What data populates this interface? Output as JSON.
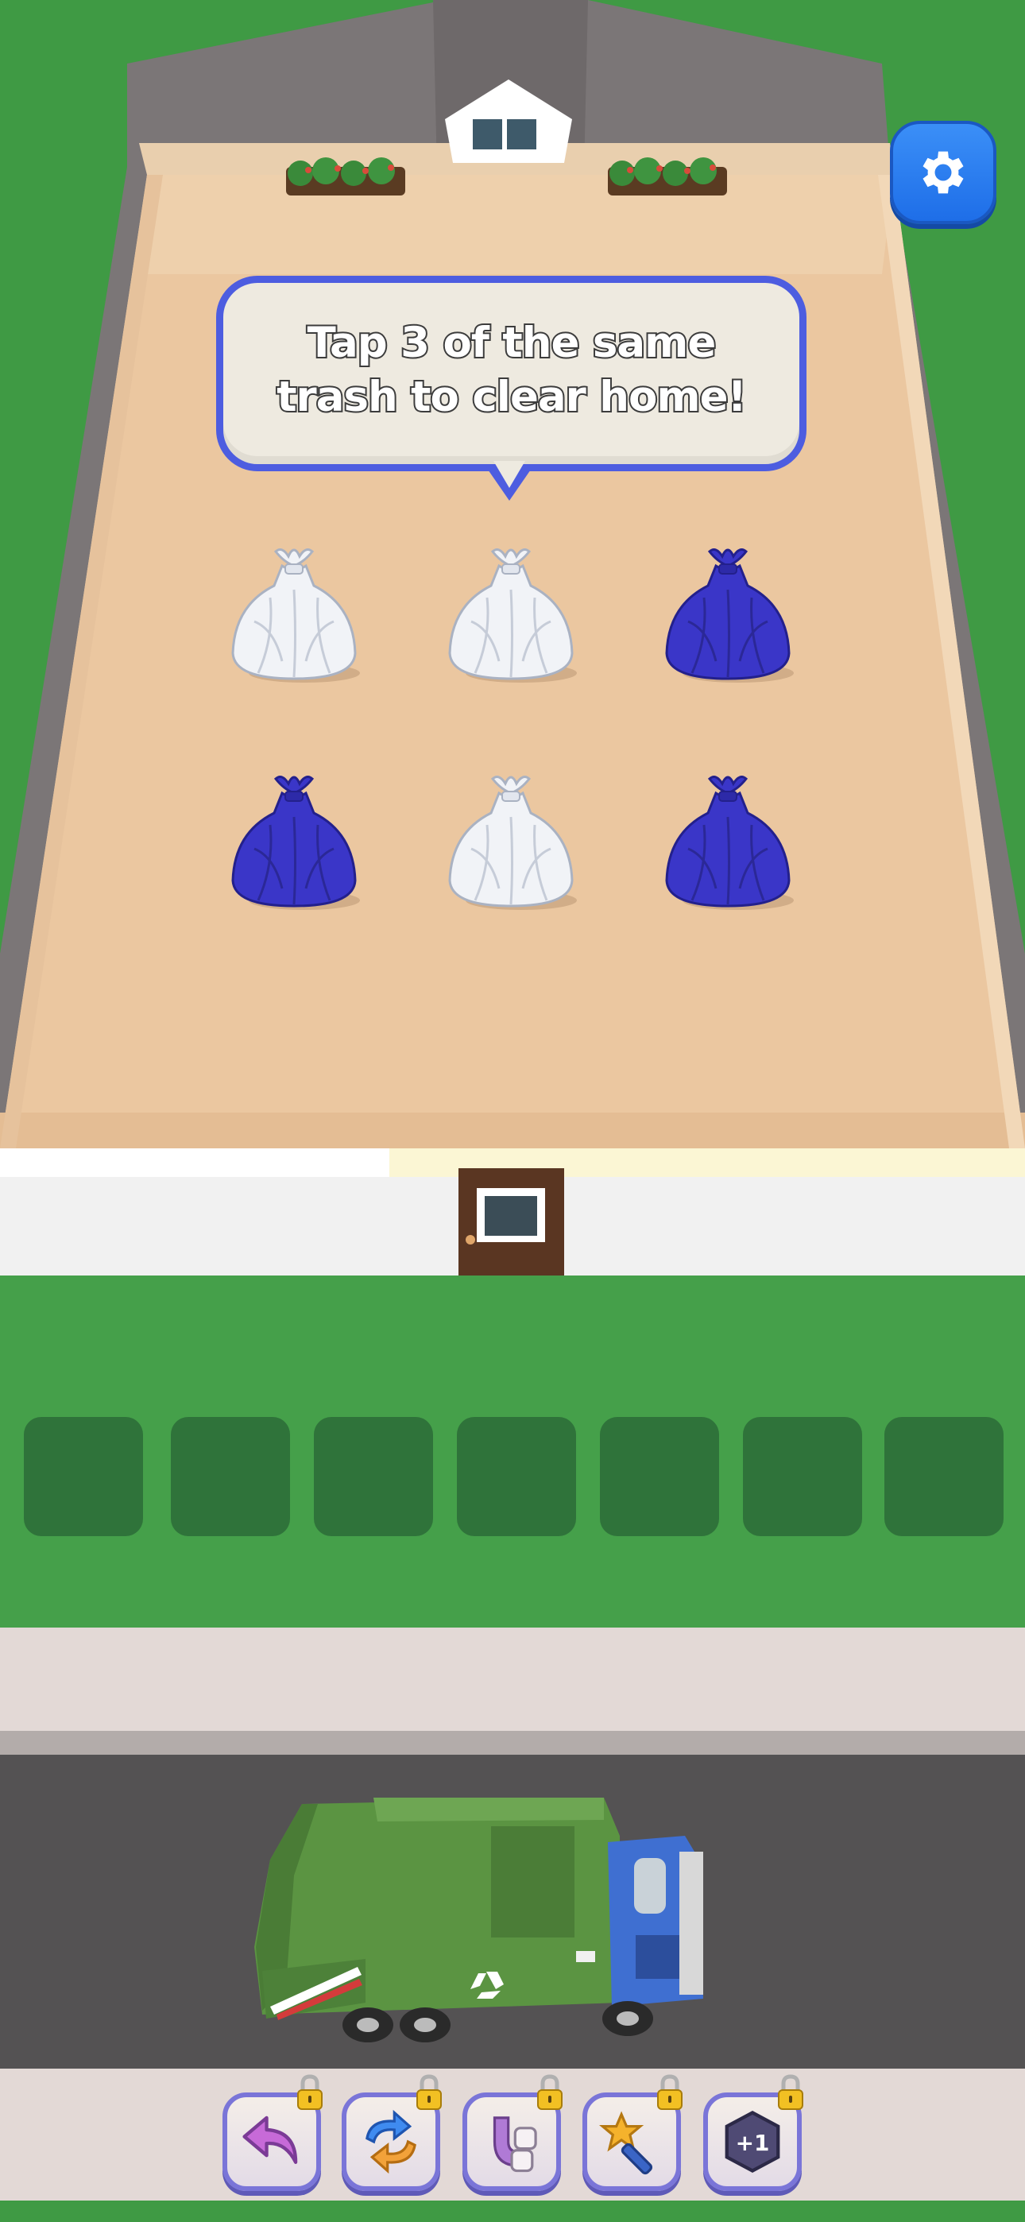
{
  "tutorial": {
    "line1": "Tap 3 of the same",
    "line2": "trash to clear home!"
  },
  "grid": {
    "rows": [
      [
        "white-bag",
        "white-bag",
        "blue-bag"
      ],
      [
        "blue-bag",
        "white-bag",
        "blue-bag"
      ]
    ]
  },
  "tray": {
    "slot_count": 7
  },
  "boosters": [
    {
      "name": "undo",
      "locked": true
    },
    {
      "name": "shuffle",
      "locked": true
    },
    {
      "name": "magnet",
      "locked": true
    },
    {
      "name": "magic-wand",
      "locked": true
    },
    {
      "name": "plus-one-slot",
      "label": "+1",
      "locked": true
    }
  ],
  "colors": {
    "grass": "#3f9a44",
    "floor": "#ebc7a0",
    "wall": "#7d7878",
    "bubble_border": "#4d5de0",
    "settings_blue": "#2a7ef0",
    "bag_blue": "#3a36c8",
    "truck_green": "#5b9442",
    "truck_cab_blue": "#3f6fd1"
  },
  "icons": {
    "settings": "gear-icon",
    "undo": "undo-arrow-icon",
    "shuffle": "shuffle-icon",
    "magnet": "magnet-icon",
    "wand": "magic-wand-icon",
    "lock": "lock-icon",
    "recycle": "recycle-icon"
  }
}
